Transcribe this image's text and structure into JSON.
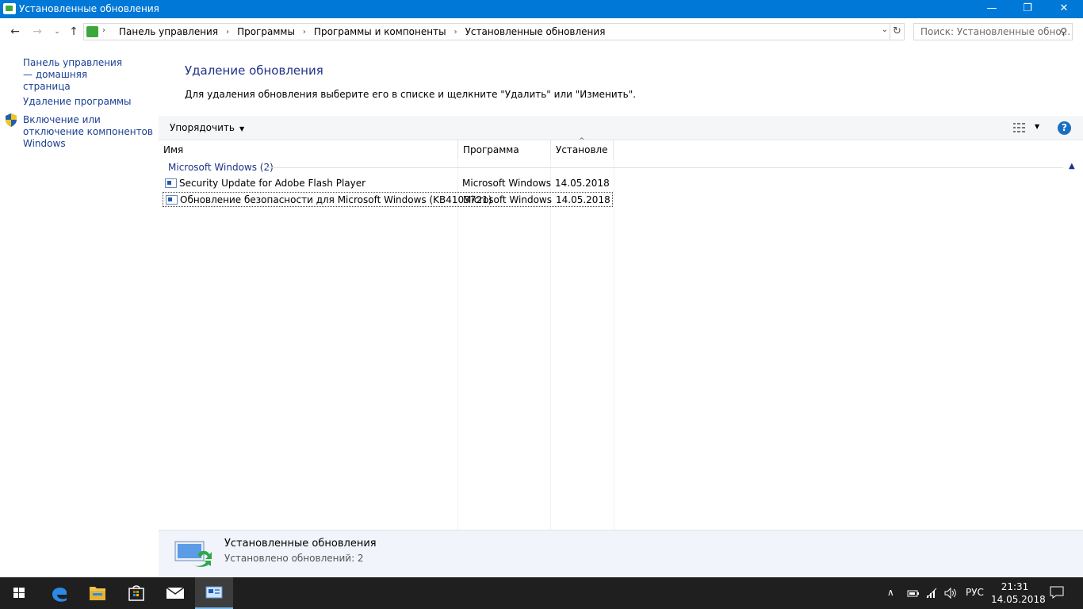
{
  "window": {
    "title": "Установленные обновления",
    "minimize_glyph": "—",
    "maximize_glyph": "❐",
    "close_glyph": "✕"
  },
  "address_bar": {
    "breadcrumbs": [
      "Панель управления",
      "Программы",
      "Программы и компоненты",
      "Установленные обновления"
    ],
    "search_placeholder": "Поиск: Установленные обно..."
  },
  "left_pane": {
    "home_link": "Панель управления — домашняя страница",
    "uninstall_link": "Удаление программы",
    "features_link": "Включение или отключение компонентов Windows"
  },
  "content": {
    "title": "Удаление обновления",
    "description": "Для удаления обновления выберите его в списке и щелкните \"Удалить\" или \"Изменить\"."
  },
  "toolbar": {
    "organize_label": "Упорядочить",
    "help_glyph": "?"
  },
  "list": {
    "columns": [
      "Имя",
      "Программа",
      "Установле"
    ],
    "group_label": "Microsoft Windows (2)",
    "rows": [
      {
        "name": "Security Update for Adobe Flash Player",
        "program": "Microsoft Windows",
        "installed": "14.05.2018"
      },
      {
        "name": "Обновление безопасности для Microsoft Windows (KB4103721)",
        "program": "Microsoft Windows",
        "installed": "14.05.2018"
      }
    ]
  },
  "details": {
    "title": "Установленные обновления",
    "count": "Установлено обновлений: 2"
  },
  "taskbar": {
    "language": "РУС",
    "time": "21:31",
    "date": "14.05.2018"
  },
  "colors": {
    "titlebar": "#0078d7",
    "link": "#1a3f93",
    "heading": "#1e3287",
    "taskbar": "#1f1f1f"
  }
}
